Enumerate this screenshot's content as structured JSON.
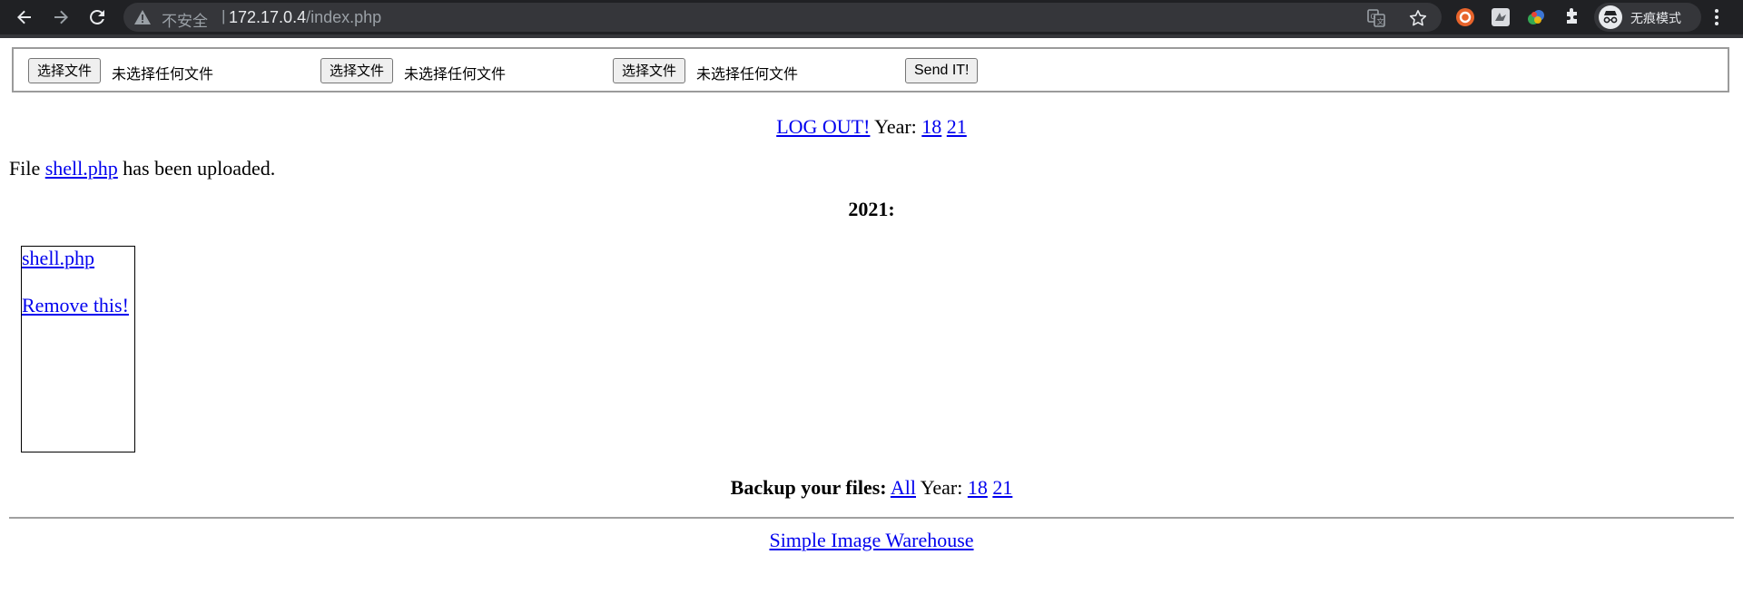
{
  "browser": {
    "insecure_label": "不安全",
    "separator": "|",
    "url_host": "172.17.0.4",
    "url_path": "/index.php",
    "incognito_label": "无痕模式",
    "colors": {
      "chrome_bg": "#202124",
      "omnibox_bg": "#35363a"
    },
    "icons": [
      "back-icon",
      "forward-icon",
      "reload-icon",
      "warning-icon",
      "translate-icon",
      "star-icon",
      "extension-orange-icon",
      "extension-bird-icon",
      "extension-colorful-icon",
      "puzzle-icon",
      "incognito-icon",
      "kebab-menu-icon"
    ]
  },
  "upload_form": {
    "inputs": [
      {
        "button_label": "选择文件",
        "status": "未选择任何文件"
      },
      {
        "button_label": "选择文件",
        "status": "未选择任何文件"
      },
      {
        "button_label": "选择文件",
        "status": "未选择任何文件"
      }
    ],
    "submit_label": "Send IT!"
  },
  "top_nav": {
    "logout_label": "LOG OUT!",
    "year_label": "Year:",
    "years": [
      "18",
      "21"
    ]
  },
  "message": {
    "prefix": "File",
    "file_link": "shell.php",
    "suffix": "has been uploaded."
  },
  "gallery": {
    "year_heading": "2021:",
    "items": [
      {
        "file_link": "shell.php",
        "remove_label": "Remove this!"
      }
    ]
  },
  "backup": {
    "label": "Backup your files:",
    "all_label": "All",
    "year_label": "Year:",
    "years": [
      "18",
      "21"
    ]
  },
  "footer": {
    "link_label": "Simple Image Warehouse"
  }
}
